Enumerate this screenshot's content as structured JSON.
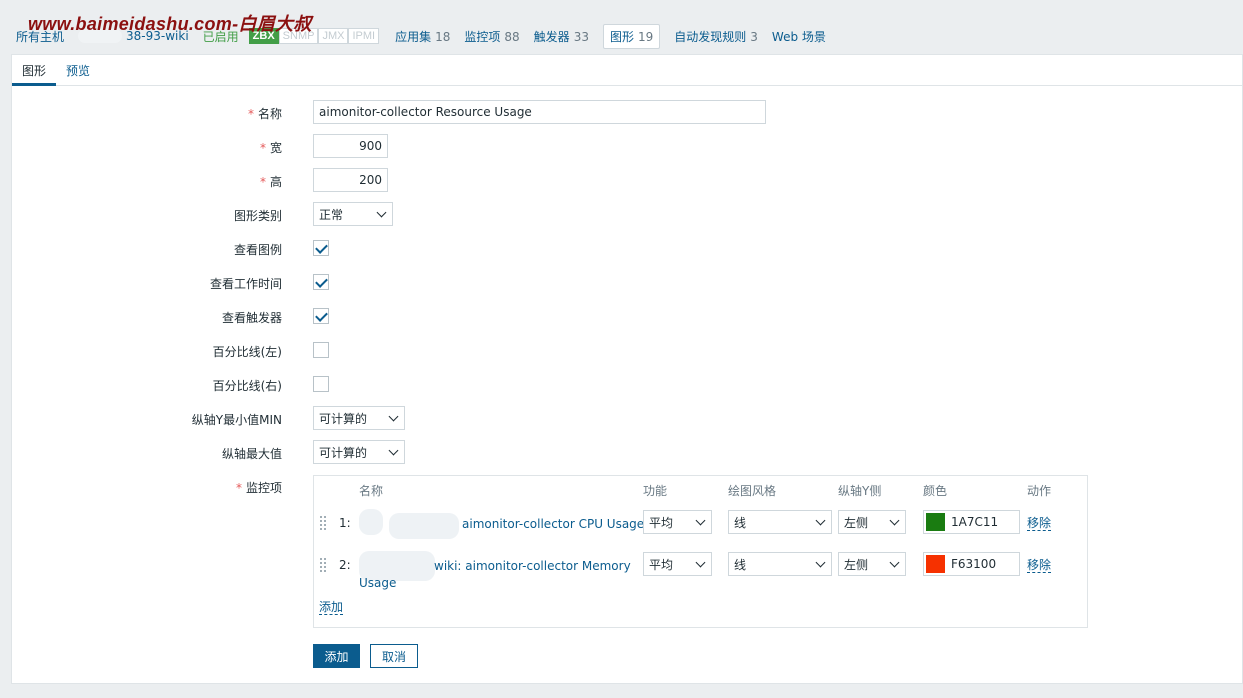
{
  "watermark": "www.baimeidashu.com-白眉大叔",
  "breadcrumb": {
    "all_hosts": "所有主机",
    "host_suffix": "38-93-wiki",
    "status": "已启用",
    "badges": [
      "ZBX",
      "SNMP",
      "JMX",
      "IPMI"
    ],
    "apps_label": "应用集",
    "apps_count": "18",
    "items_label": "监控项",
    "items_count": "88",
    "triggers_label": "触发器",
    "triggers_count": "33",
    "graphs_label": "图形",
    "graphs_count": "19",
    "discovery_label": "自动发现规则",
    "discovery_count": "3",
    "web_label": "Web 场景"
  },
  "tabs": {
    "graph": "图形",
    "preview": "预览"
  },
  "form": {
    "name_label": "名称",
    "name_value": "aimonitor-collector Resource Usage",
    "width_label": "宽",
    "width_value": "900",
    "height_label": "高",
    "height_value": "200",
    "type_label": "图形类别",
    "type_value": "正常",
    "legend_label": "查看图例",
    "worktime_label": "查看工作时间",
    "triggers_label": "查看触发器",
    "percent_left_label": "百分比线(左)",
    "percent_right_label": "百分比线(右)",
    "ymin_label": "纵轴Y最小值MIN",
    "ymin_value": "可计算的",
    "ymax_label": "纵轴最大值",
    "ymax_value": "可计算的",
    "items_label": "监控项"
  },
  "items_table": {
    "headers": {
      "name": "名称",
      "func": "功能",
      "style": "绘图风格",
      "axis": "纵轴Y侧",
      "color": "颜色",
      "action": "动作"
    },
    "rows": [
      {
        "idx": "1:",
        "name": "aimonitor-collector CPU Usage",
        "func": "平均",
        "style": "线",
        "axis": "左侧",
        "color": "1A7C11",
        "color_hex": "#1a7c11",
        "action": "移除"
      },
      {
        "idx": "2:",
        "name_line1": "wiki: aimonitor-collector Memory",
        "name_line2": "Usage",
        "func": "平均",
        "style": "线",
        "axis": "左侧",
        "color": "F63100",
        "color_hex": "#f63100",
        "action": "移除"
      }
    ],
    "add_link": "添加"
  },
  "buttons": {
    "add": "添加",
    "cancel": "取消"
  }
}
